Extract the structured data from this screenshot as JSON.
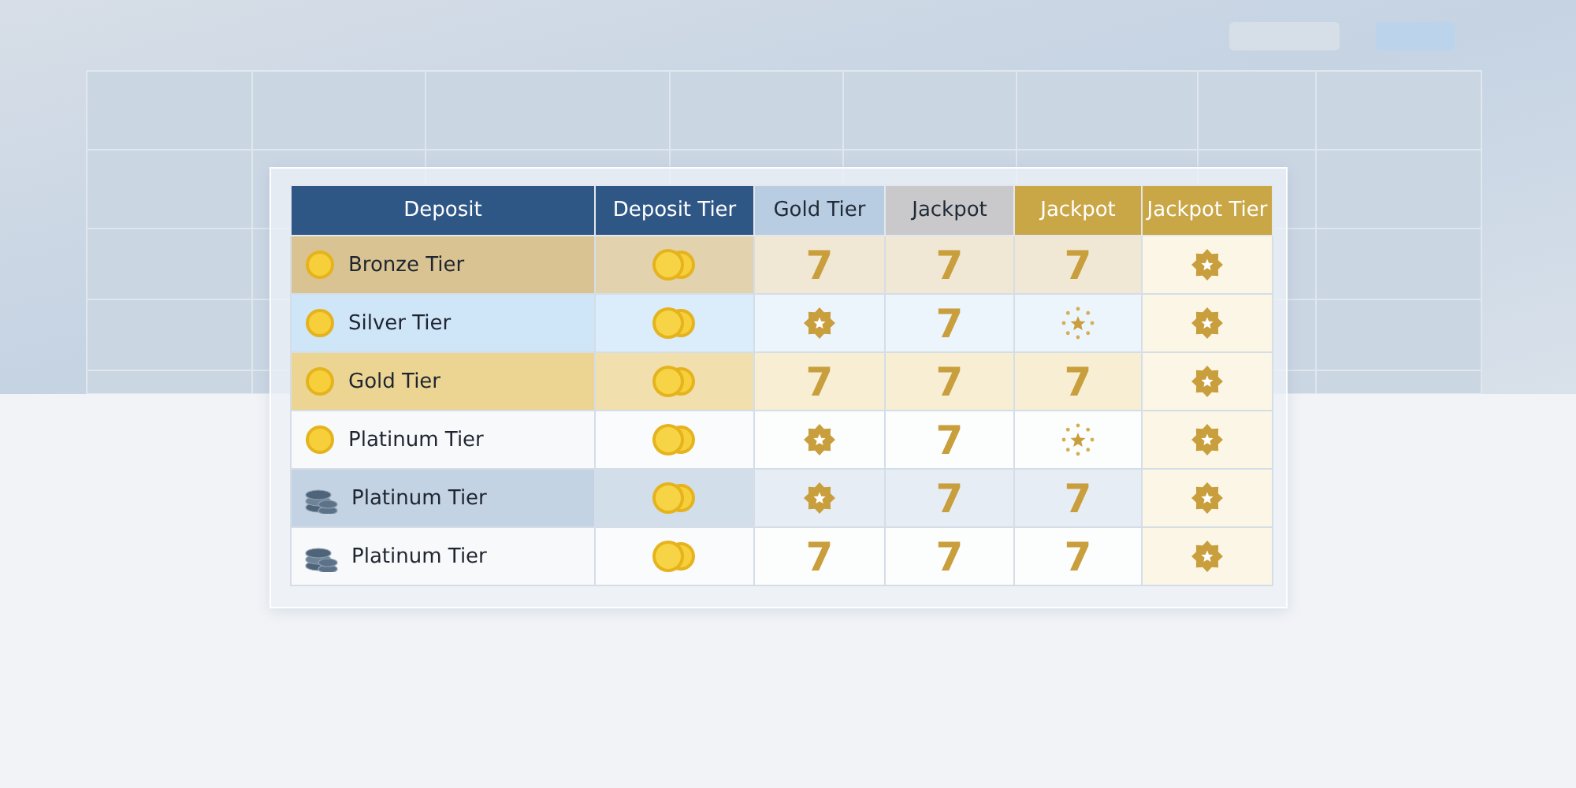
{
  "table": {
    "columns": [
      {
        "label": "Deposit",
        "color": "#2f5786"
      },
      {
        "label": "Deposit Tier",
        "color": "#2f5786"
      },
      {
        "label": "Gold Tier",
        "color": "#b8cde2"
      },
      {
        "label": "Jackpot",
        "color": "#c9c9cb"
      },
      {
        "label": "Jackpot",
        "color": "#c9a646"
      },
      {
        "label": "Jackpot Tier",
        "color": "#c9a646"
      }
    ],
    "rows": [
      {
        "color": "#d9c393",
        "cells": [
          {
            "kind": "coin",
            "text": "Bronze Tier"
          },
          {
            "kind": "coins"
          },
          {
            "kind": "seven",
            "text": "7"
          },
          {
            "kind": "seven",
            "text": "7"
          },
          {
            "kind": "seven",
            "text": "7"
          },
          {
            "kind": "badge"
          }
        ]
      },
      {
        "color": "#cfe5f8",
        "cells": [
          {
            "kind": "coin",
            "text": "Silver Tier"
          },
          {
            "kind": "coins"
          },
          {
            "kind": "badge"
          },
          {
            "kind": "seven",
            "text": "7"
          },
          {
            "kind": "sparkle"
          },
          {
            "kind": "badge"
          }
        ]
      },
      {
        "color": "#ecd593",
        "cells": [
          {
            "kind": "coin",
            "text": "Gold Tier"
          },
          {
            "kind": "coins"
          },
          {
            "kind": "seven",
            "text": "7"
          },
          {
            "kind": "seven",
            "text": "7"
          },
          {
            "kind": "seven",
            "text": "7"
          },
          {
            "kind": "badge"
          }
        ]
      },
      {
        "color": "#f8f9fb",
        "cells": [
          {
            "kind": "coin",
            "text": "Platinum Tier"
          },
          {
            "kind": "coins"
          },
          {
            "kind": "badge"
          },
          {
            "kind": "seven",
            "text": "7"
          },
          {
            "kind": "sparkle"
          },
          {
            "kind": "badge"
          }
        ]
      },
      {
        "color": "#c3d3e3",
        "cells": [
          {
            "kind": "stack",
            "text": "Platinum Tier"
          },
          {
            "kind": "coins"
          },
          {
            "kind": "badge"
          },
          {
            "kind": "seven",
            "text": "7"
          },
          {
            "kind": "seven",
            "text": "7"
          },
          {
            "kind": "badge"
          }
        ]
      },
      {
        "color": "#f8f9fb",
        "cells": [
          {
            "kind": "stack",
            "text": "Platinum Tier"
          },
          {
            "kind": "coins"
          },
          {
            "kind": "seven",
            "text": "7"
          },
          {
            "kind": "seven",
            "text": "7"
          },
          {
            "kind": "seven",
            "text": "7"
          },
          {
            "kind": "badge"
          }
        ]
      }
    ]
  }
}
